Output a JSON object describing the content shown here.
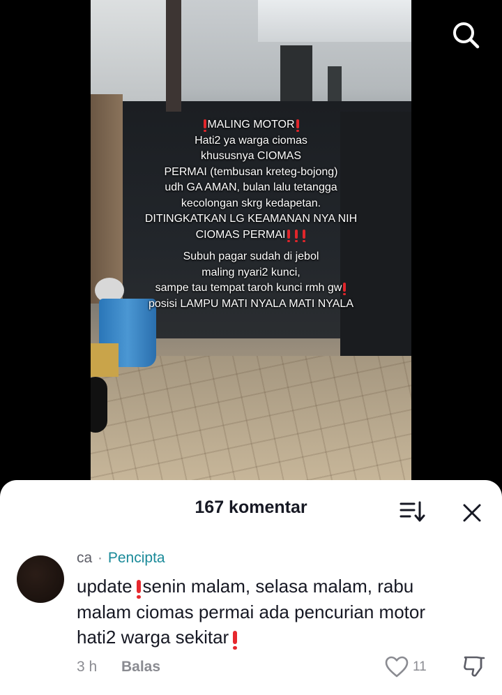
{
  "video": {
    "overlay_lines_1": [
      {
        "pre_excl": true,
        "text": "MALING MOTOR",
        "post_excl": 1
      },
      {
        "pre_excl": false,
        "text": "Hati2 ya warga ciomas",
        "post_excl": 0
      },
      {
        "pre_excl": false,
        "text": "khususnya CIOMAS",
        "post_excl": 0
      },
      {
        "pre_excl": false,
        "text": "PERMAI (tembusan kreteg-bojong)",
        "post_excl": 0
      },
      {
        "pre_excl": false,
        "text": "udh GA AMAN, bulan lalu tetangga",
        "post_excl": 0
      },
      {
        "pre_excl": false,
        "text": "kecolongan skrg kedapetan.",
        "post_excl": 0
      },
      {
        "pre_excl": false,
        "text": "DITINGKATKAN LG KEAMANAN NYA NIH",
        "post_excl": 0
      },
      {
        "pre_excl": false,
        "text": "CIOMAS PERMAI",
        "post_excl": 3
      }
    ],
    "overlay_lines_2": [
      {
        "pre_excl": false,
        "text": "Subuh pagar sudah di jebol",
        "post_excl": 0
      },
      {
        "pre_excl": false,
        "text": "maling nyari2 kunci,",
        "post_excl": 0
      },
      {
        "pre_excl": false,
        "text": "sampe tau tempat taroh kunci rmh gw",
        "post_excl": 1
      },
      {
        "pre_excl": false,
        "text": "posisi LAMPU MATI NYALA MATI NYALA",
        "post_excl": 0
      }
    ],
    "search_icon": "search-icon"
  },
  "sheet": {
    "title": "167 komentar",
    "sort_icon": "sort-icon",
    "close_icon": "close-icon"
  },
  "comment": {
    "author": "ca",
    "separator": "·",
    "creator_badge": "Pencipta",
    "lines": [
      {
        "before": "update",
        "after": "senin malam, selasa malam, rabu",
        "excl": true
      },
      {
        "before": "malam ciomas permai ada pencurian motor",
        "after": "",
        "excl": false
      },
      {
        "before": "hati2 warga sekitar",
        "after": "",
        "excl": true
      }
    ],
    "time": "3 h",
    "reply_label": "Balas",
    "like_count": "11",
    "like_icon": "heart-outline-icon",
    "dislike_icon": "thumbs-down-icon"
  },
  "colors": {
    "creator": "#1a8a99",
    "emoji_red": "#e6282e",
    "text_primary": "#161823",
    "text_secondary": "#8a8b91"
  }
}
